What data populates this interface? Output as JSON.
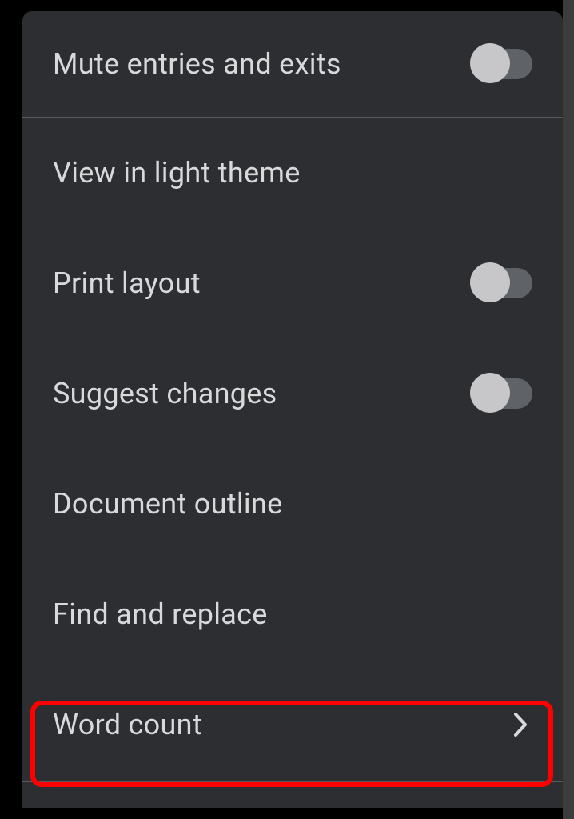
{
  "menu": {
    "items": [
      {
        "label": "Mute entries and exits",
        "type": "toggle",
        "state": "off"
      },
      {
        "label": "View in light theme",
        "type": "action"
      },
      {
        "label": "Print layout",
        "type": "toggle",
        "state": "off"
      },
      {
        "label": "Suggest changes",
        "type": "toggle",
        "state": "off"
      },
      {
        "label": "Document outline",
        "type": "action"
      },
      {
        "label": "Find and replace",
        "type": "action"
      },
      {
        "label": "Word count",
        "type": "submenu"
      }
    ]
  }
}
